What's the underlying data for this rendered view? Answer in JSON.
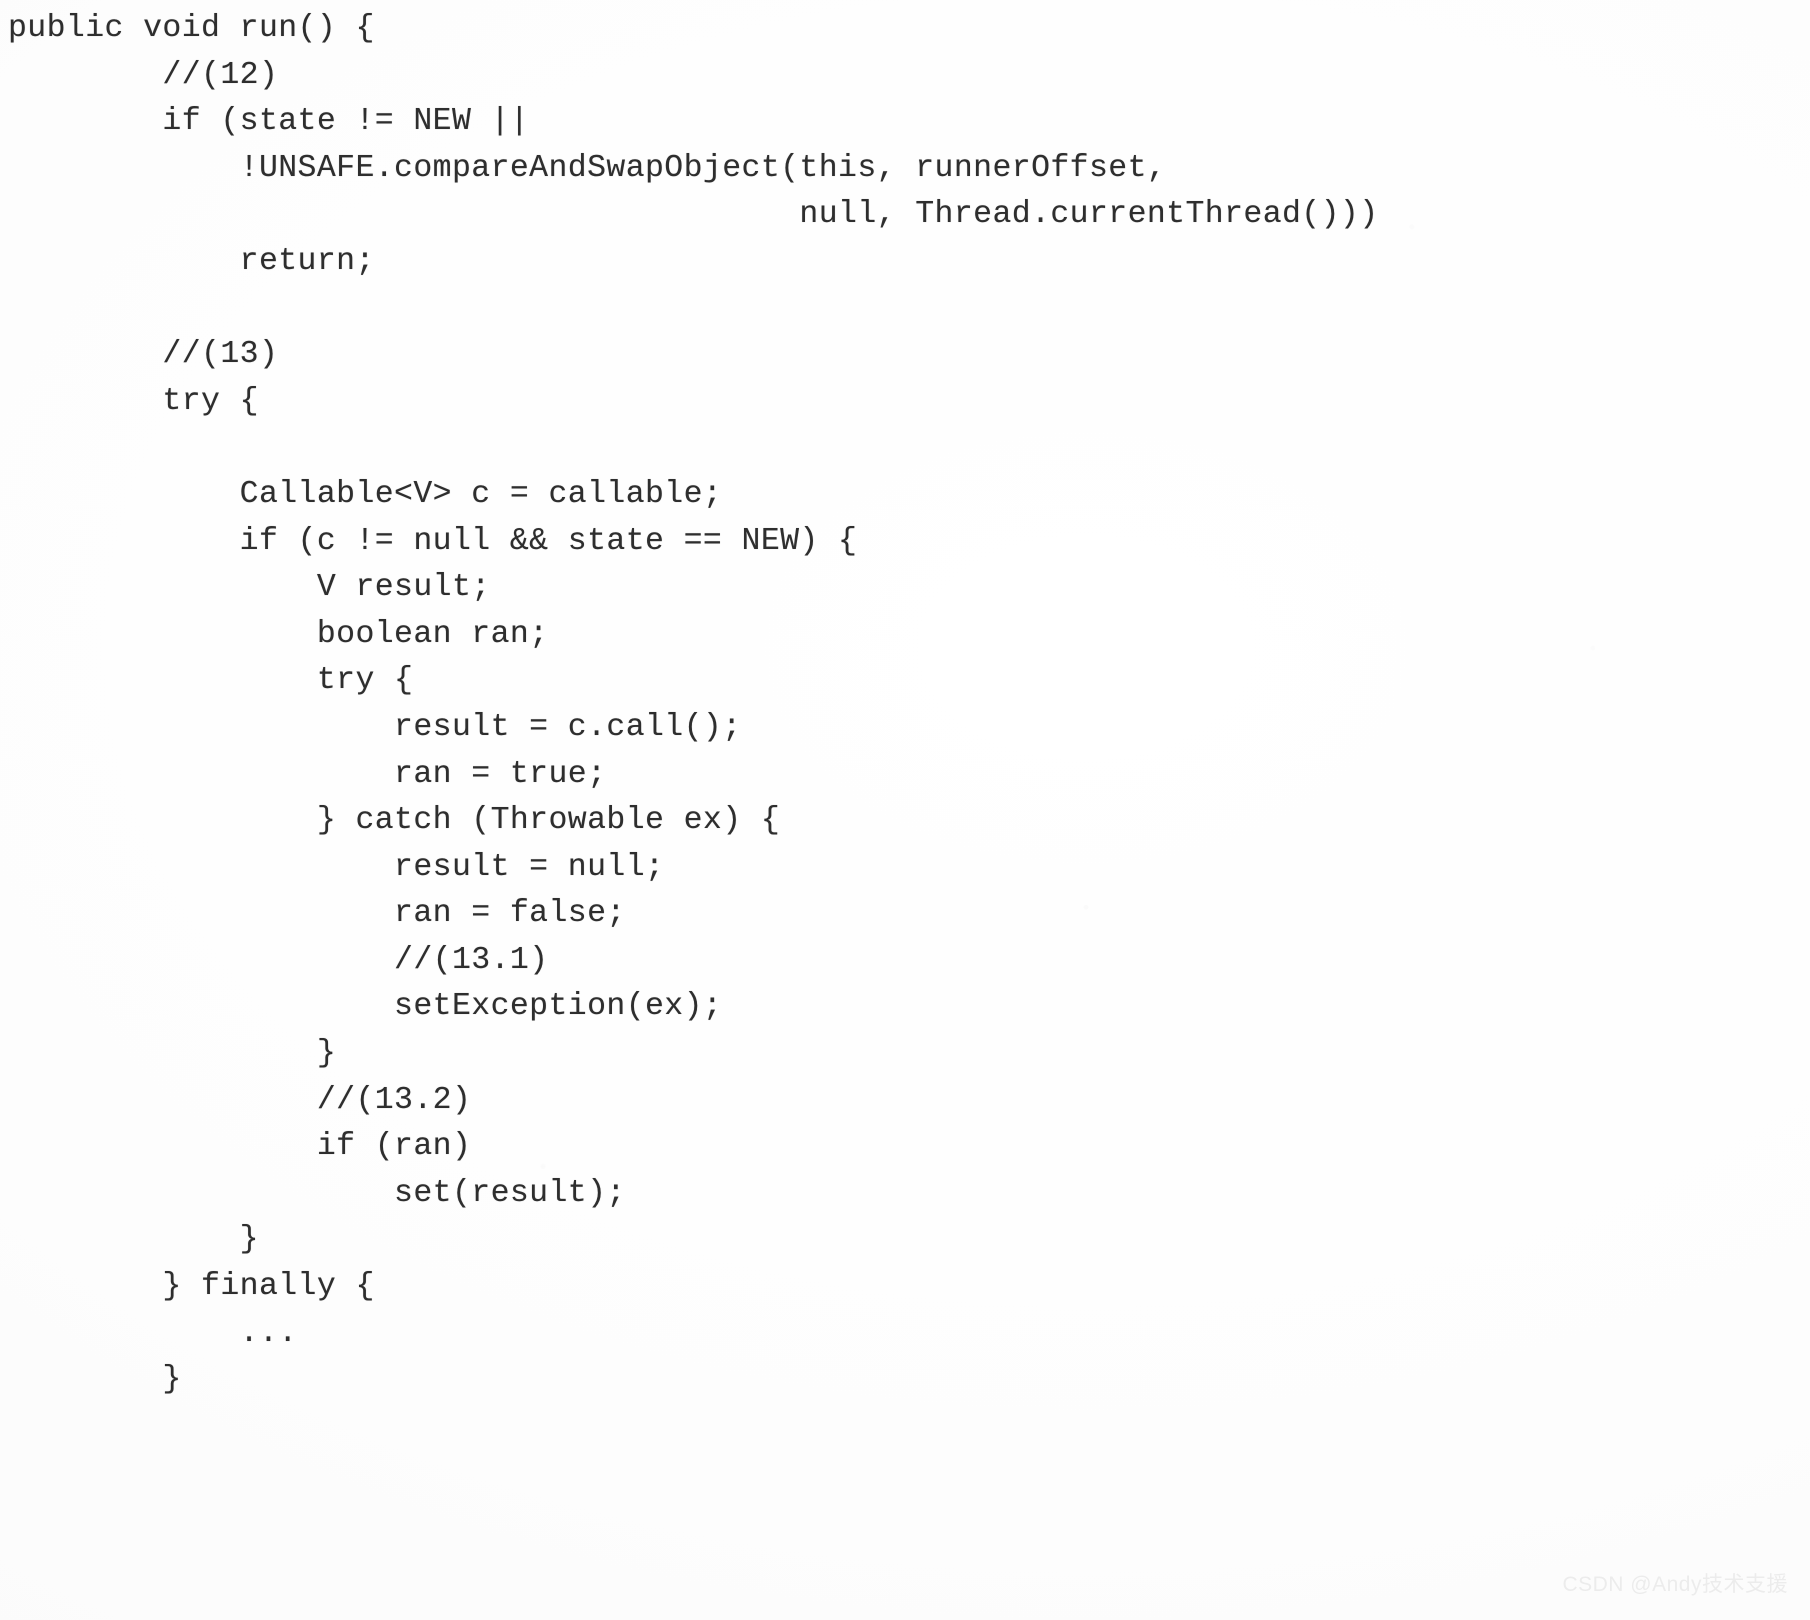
{
  "document": {
    "type": "code-listing",
    "language": "Java",
    "background_color": "#ffffff",
    "text_color": "#2e2e2e"
  },
  "code": {
    "lines": [
      "public void run() {",
      "        //(12)",
      "        if (state != NEW ||",
      "            !UNSAFE.compareAndSwapObject(this, runnerOffset,",
      "                                         null, Thread.currentThread()))",
      "            return;",
      "",
      "        //(13)",
      "        try {",
      "",
      "            Callable<V> c = callable;",
      "            if (c != null && state == NEW) {",
      "                V result;",
      "                boolean ran;",
      "                try {",
      "                    result = c.call();",
      "                    ran = true;",
      "                } catch (Throwable ex) {",
      "                    result = null;",
      "                    ran = false;",
      "                    //(13.1)",
      "                    setException(ex);",
      "                }",
      "                //(13.2)",
      "                if (ran)",
      "                    set(result);",
      "            }",
      "        } finally {",
      "            ...",
      "        }"
    ]
  },
  "watermark": {
    "text": "CSDN @Andy技术支援",
    "color": "#ececec"
  }
}
